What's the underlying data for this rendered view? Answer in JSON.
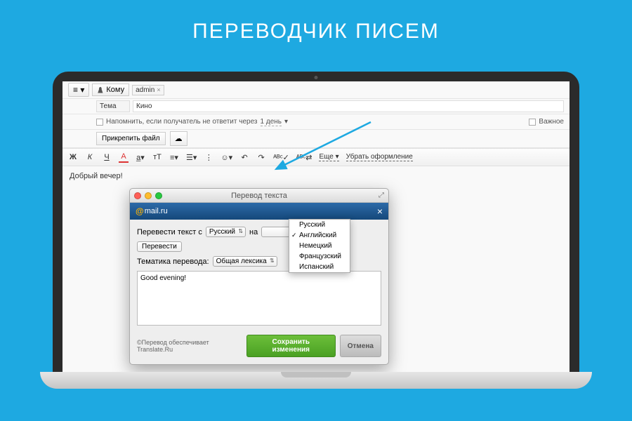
{
  "hero": {
    "title": "ПЕРЕВОДЧИК ПИСЕМ"
  },
  "compose": {
    "to_label": "Кому",
    "recipient": "admin",
    "subject_label": "Тема",
    "subject": "Кино",
    "remind_label": "Напомнить, если получатель не ответит через",
    "remind_days": "1 день",
    "important_label": "Важное",
    "attach_label": "Прикрепить файл",
    "cloud_icon": "☁",
    "toolbar": {
      "bold": "Ж",
      "italic": "К",
      "underline": "Ч",
      "color": "А",
      "fontsize": "тТ",
      "align": "≡",
      "list": "≡",
      "modes": "⋮",
      "emoji": "☺",
      "undo": "↶",
      "redo": "↷",
      "spellcheck": "ᴬᴮᶜ✓",
      "translate": "ᴬᴮᶜ⇄",
      "more": "Еще",
      "clear": "Убрать оформление"
    },
    "body_text": "Добрый вечер!"
  },
  "dialog": {
    "mac_title": "Перевод текста",
    "brand_at": "@",
    "brand_name": "mail.ru",
    "translate_from_label": "Перевести текст с",
    "from_lang": "Русский",
    "to_label": "на",
    "translate_btn": "Перевести",
    "topic_label": "Тематика перевода:",
    "topic_value": "Общая лексика",
    "result_text": "Good evening!",
    "copyright": "©Перевод обеспечивает Translate.Ru",
    "save_btn": "Сохранить изменения",
    "cancel_btn": "Отмена"
  },
  "languages": [
    {
      "name": "Русский",
      "checked": false
    },
    {
      "name": "Английский",
      "checked": true
    },
    {
      "name": "Немецкий",
      "checked": false
    },
    {
      "name": "Французский",
      "checked": false
    },
    {
      "name": "Испанский",
      "checked": false
    }
  ]
}
